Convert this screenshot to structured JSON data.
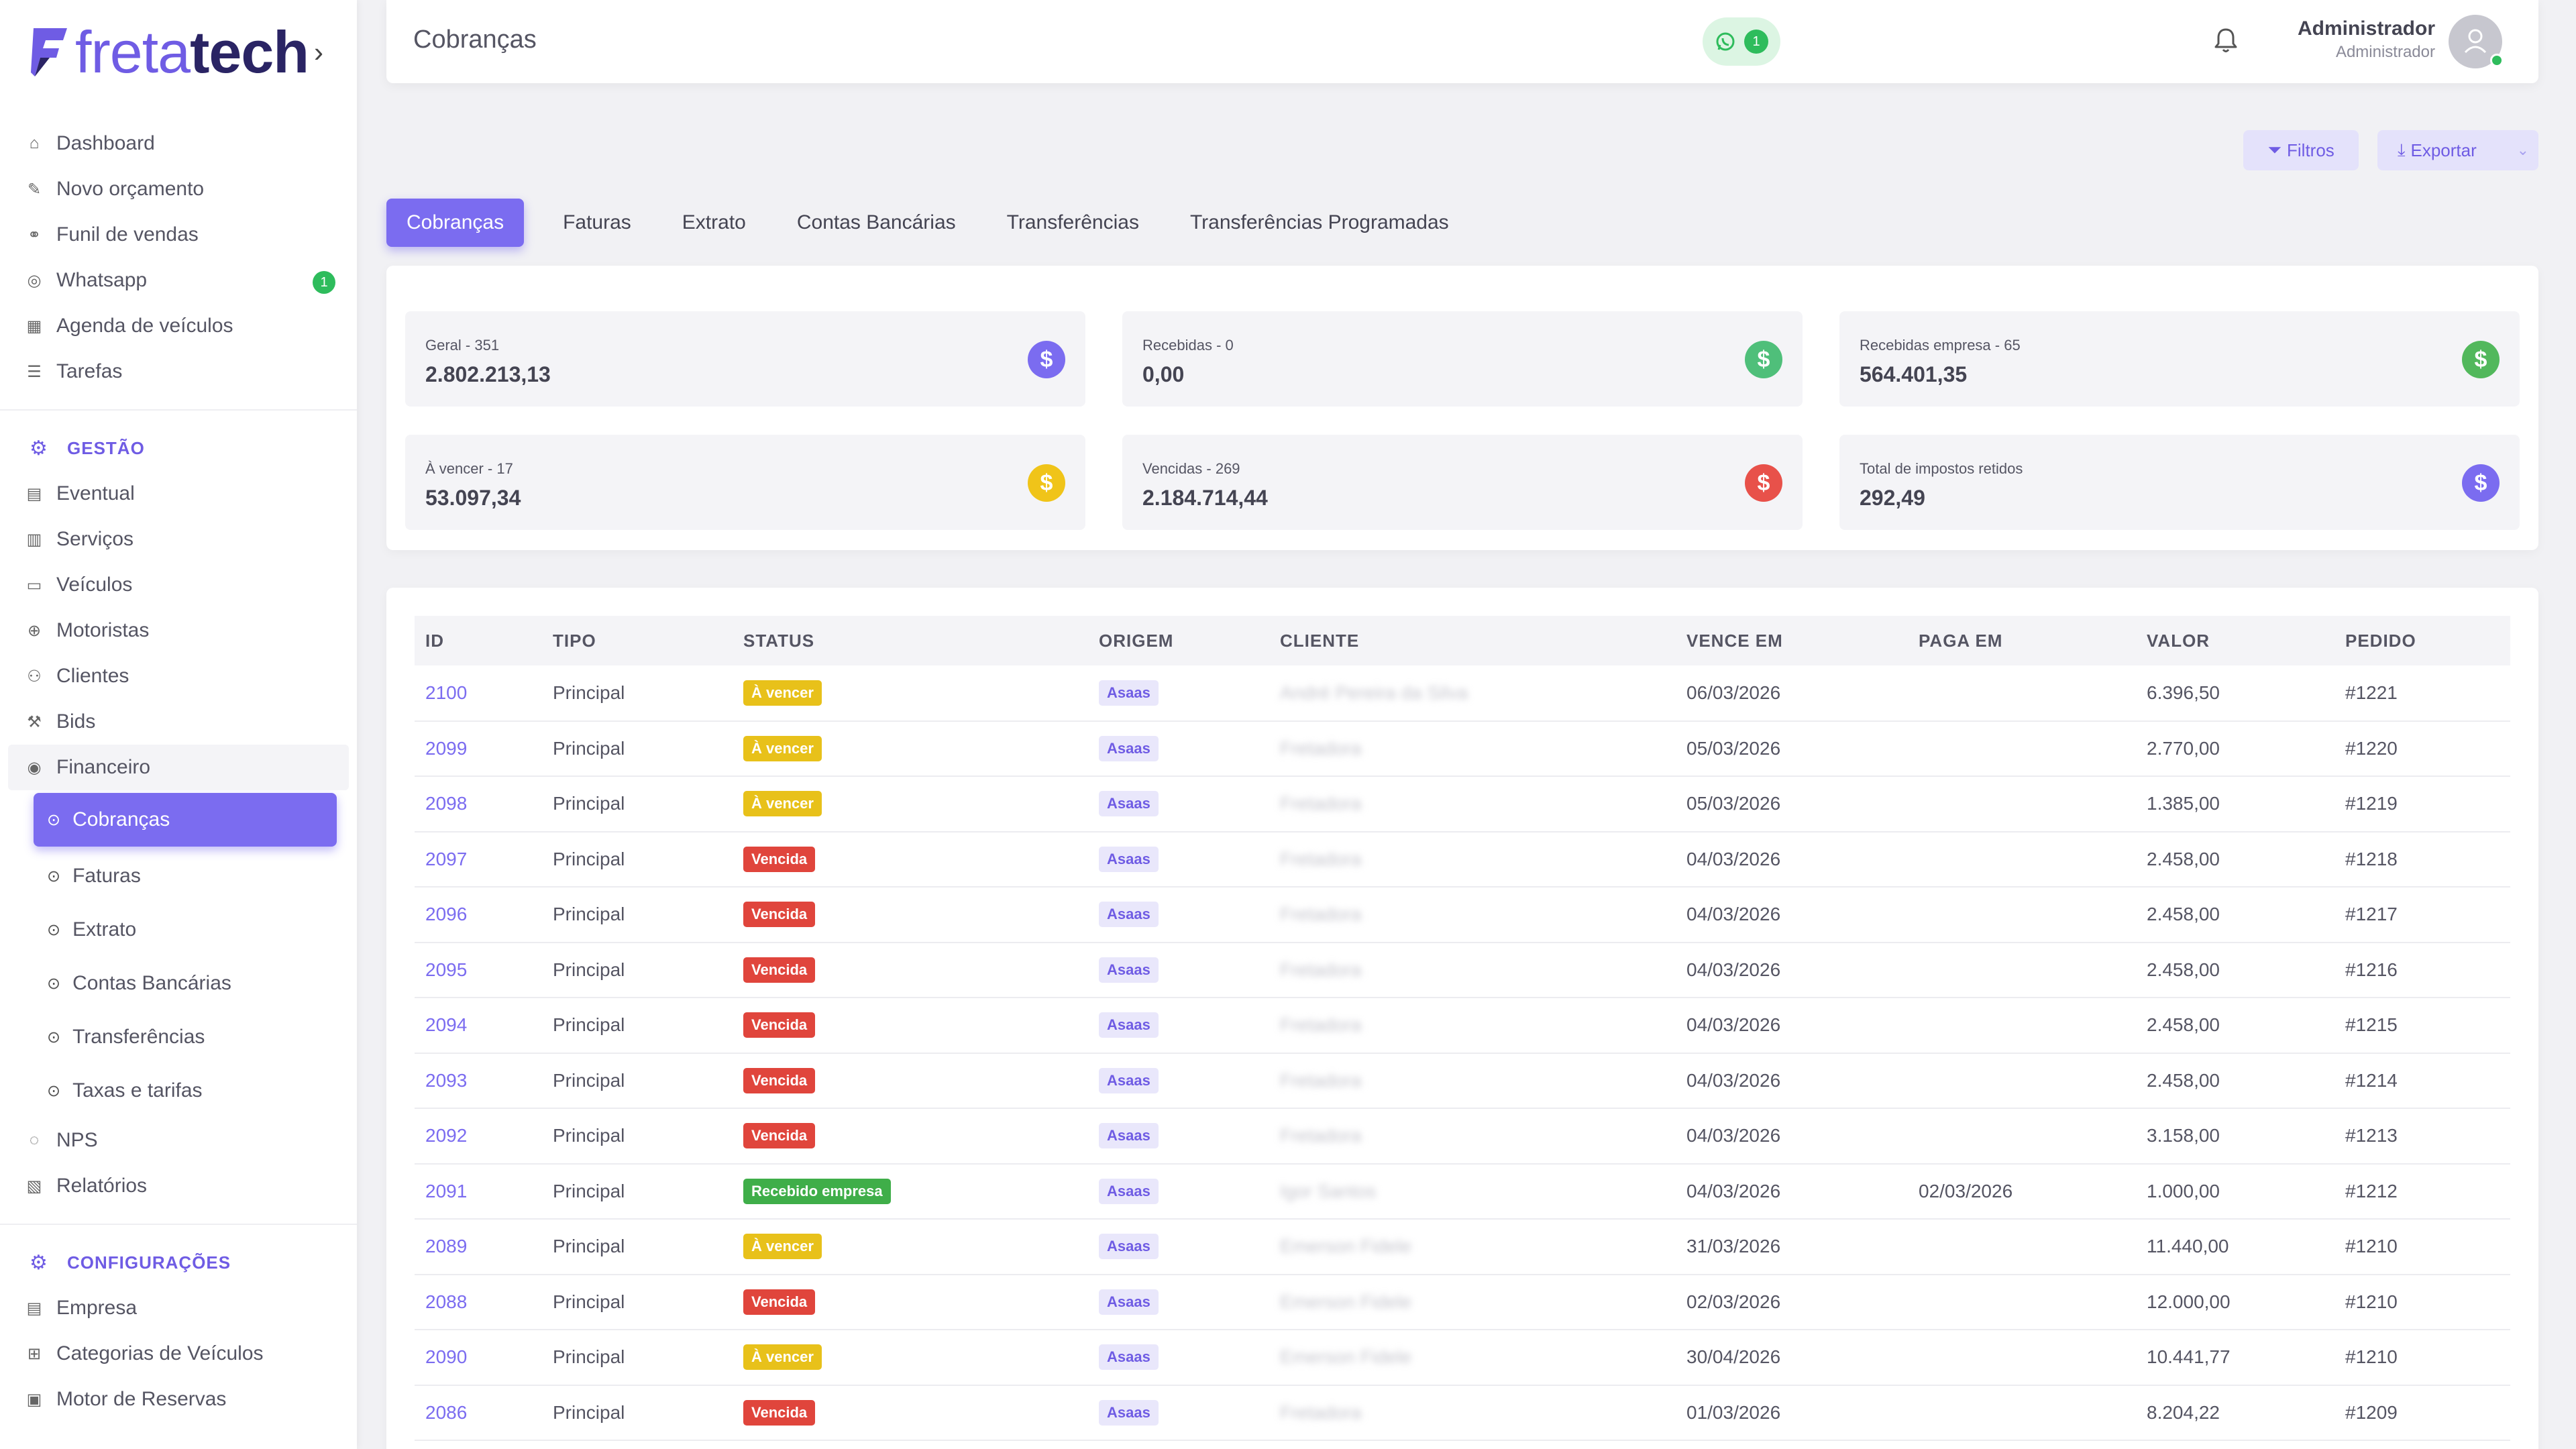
{
  "brand": {
    "logo_regular": "freta",
    "logo_bold": "tech",
    "accent": "#7b6cf0"
  },
  "sidebar": {
    "items": [
      {
        "label": "Dashboard",
        "icon": "home-icon"
      },
      {
        "label": "Novo orçamento",
        "icon": "edit-icon"
      },
      {
        "label": "Funil de vendas",
        "icon": "funnel-icon"
      },
      {
        "label": "Whatsapp",
        "icon": "whatsapp-icon",
        "badge": "1"
      },
      {
        "label": "Agenda de veículos",
        "icon": "calendar-icon"
      },
      {
        "label": "Tarefas",
        "icon": "tasks-icon"
      }
    ],
    "gestao_title": "GESTÃO",
    "gestao_items": [
      {
        "label": "Eventual"
      },
      {
        "label": "Serviços"
      },
      {
        "label": "Veículos"
      },
      {
        "label": "Motoristas"
      },
      {
        "label": "Clientes"
      },
      {
        "label": "Bids"
      }
    ],
    "financeiro": "Financeiro",
    "financeiro_sub": [
      {
        "label": "Cobranças"
      },
      {
        "label": "Faturas"
      },
      {
        "label": "Extrato"
      },
      {
        "label": "Contas Bancárias"
      },
      {
        "label": "Transferências"
      },
      {
        "label": "Taxas e tarifas"
      }
    ],
    "after_items": [
      {
        "label": "NPS"
      },
      {
        "label": "Relatórios"
      }
    ],
    "config_title": "CONFIGURAÇÕES",
    "config_items": [
      {
        "label": "Empresa"
      },
      {
        "label": "Categorias de Veículos"
      },
      {
        "label": "Motor de Reservas"
      }
    ]
  },
  "header": {
    "title": "Cobranças",
    "whatsapp_count": "1",
    "user_name": "Administrador",
    "user_role": "Administrador"
  },
  "actions": {
    "filter": "Filtros",
    "export": "Exportar"
  },
  "tabs": [
    "Cobranças",
    "Faturas",
    "Extrato",
    "Contas Bancárias",
    "Transferências",
    "Transferências Programadas"
  ],
  "stats": [
    {
      "label": "Geral - 351",
      "value": "2.802.213,13",
      "color": "#7b6cf0"
    },
    {
      "label": "Recebidas - 0",
      "value": "0,00",
      "color": "#4fbf7a"
    },
    {
      "label": "Recebidas empresa - 65",
      "value": "564.401,35",
      "color": "#52b85c"
    },
    {
      "label": "À vencer - 17",
      "value": "53.097,34",
      "color": "#f0c419"
    },
    {
      "label": "Vencidas - 269",
      "value": "2.184.714,44",
      "color": "#e8514a"
    },
    {
      "label": "Total de impostos retidos",
      "value": "292,49",
      "color": "#7b6cf0"
    }
  ],
  "status_colors": {
    "À vencer": "#e8c11a",
    "Vencida": "#e0453c",
    "Recebido empresa": "#3fae49"
  },
  "table": {
    "columns": [
      "ID",
      "TIPO",
      "STATUS",
      "ORIGEM",
      "CLIENTE",
      "VENCE EM",
      "PAGA EM",
      "VALOR",
      "PEDIDO"
    ],
    "rows": [
      {
        "id": "2100",
        "tipo": "Principal",
        "status": "À vencer",
        "origem": "Asaas",
        "cliente": "André Pereira da Silva",
        "vence": "06/03/2026",
        "paga": "",
        "valor": "6.396,50",
        "pedido": "#1221"
      },
      {
        "id": "2099",
        "tipo": "Principal",
        "status": "À vencer",
        "origem": "Asaas",
        "cliente": "Fretadora",
        "vence": "05/03/2026",
        "paga": "",
        "valor": "2.770,00",
        "pedido": "#1220"
      },
      {
        "id": "2098",
        "tipo": "Principal",
        "status": "À vencer",
        "origem": "Asaas",
        "cliente": "Fretadora",
        "vence": "05/03/2026",
        "paga": "",
        "valor": "1.385,00",
        "pedido": "#1219"
      },
      {
        "id": "2097",
        "tipo": "Principal",
        "status": "Vencida",
        "origem": "Asaas",
        "cliente": "Fretadora",
        "vence": "04/03/2026",
        "paga": "",
        "valor": "2.458,00",
        "pedido": "#1218"
      },
      {
        "id": "2096",
        "tipo": "Principal",
        "status": "Vencida",
        "origem": "Asaas",
        "cliente": "Fretadora",
        "vence": "04/03/2026",
        "paga": "",
        "valor": "2.458,00",
        "pedido": "#1217"
      },
      {
        "id": "2095",
        "tipo": "Principal",
        "status": "Vencida",
        "origem": "Asaas",
        "cliente": "Fretadora",
        "vence": "04/03/2026",
        "paga": "",
        "valor": "2.458,00",
        "pedido": "#1216"
      },
      {
        "id": "2094",
        "tipo": "Principal",
        "status": "Vencida",
        "origem": "Asaas",
        "cliente": "Fretadora",
        "vence": "04/03/2026",
        "paga": "",
        "valor": "2.458,00",
        "pedido": "#1215"
      },
      {
        "id": "2093",
        "tipo": "Principal",
        "status": "Vencida",
        "origem": "Asaas",
        "cliente": "Fretadora",
        "vence": "04/03/2026",
        "paga": "",
        "valor": "2.458,00",
        "pedido": "#1214"
      },
      {
        "id": "2092",
        "tipo": "Principal",
        "status": "Vencida",
        "origem": "Asaas",
        "cliente": "Fretadora",
        "vence": "04/03/2026",
        "paga": "",
        "valor": "3.158,00",
        "pedido": "#1213"
      },
      {
        "id": "2091",
        "tipo": "Principal",
        "status": "Recebido empresa",
        "origem": "Asaas",
        "cliente": "Igor Santos",
        "vence": "04/03/2026",
        "paga": "02/03/2026",
        "valor": "1.000,00",
        "pedido": "#1212"
      },
      {
        "id": "2089",
        "tipo": "Principal",
        "status": "À vencer",
        "origem": "Asaas",
        "cliente": "Emerson Fidele",
        "vence": "31/03/2026",
        "paga": "",
        "valor": "11.440,00",
        "pedido": "#1210"
      },
      {
        "id": "2088",
        "tipo": "Principal",
        "status": "Vencida",
        "origem": "Asaas",
        "cliente": "Emerson Fidele",
        "vence": "02/03/2026",
        "paga": "",
        "valor": "12.000,00",
        "pedido": "#1210"
      },
      {
        "id": "2090",
        "tipo": "Principal",
        "status": "À vencer",
        "origem": "Asaas",
        "cliente": "Emerson Fidele",
        "vence": "30/04/2026",
        "paga": "",
        "valor": "10.441,77",
        "pedido": "#1210"
      },
      {
        "id": "2086",
        "tipo": "Principal",
        "status": "Vencida",
        "origem": "Asaas",
        "cliente": "Fretadora",
        "vence": "01/03/2026",
        "paga": "",
        "valor": "8.204,22",
        "pedido": "#1209"
      }
    ]
  }
}
